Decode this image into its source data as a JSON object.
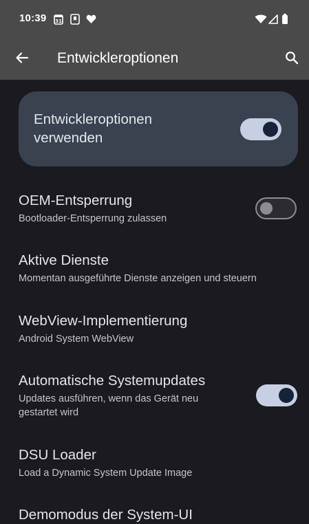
{
  "status_bar": {
    "time": "10:39",
    "left_icons": [
      "calendar-icon",
      "bookmark-icon",
      "heart-icon"
    ],
    "right_icons": [
      "wifi-icon",
      "signal-icon",
      "battery-icon"
    ],
    "calendar_day": "31"
  },
  "app_bar": {
    "title": "Entwickleroptionen",
    "back_icon": "arrow-back-icon",
    "search_icon": "search-icon"
  },
  "master_toggle": {
    "label": "Entwickleroptionen verwenden",
    "checked": true
  },
  "settings": [
    {
      "title": "OEM-Entsperrung",
      "subtitle": "Bootloader-Entsperrung zulassen",
      "toggle": false
    },
    {
      "title": "Aktive Dienste",
      "subtitle": "Momentan ausgeführte Dienste anzeigen und steuern"
    },
    {
      "title": "WebView-Implementierung",
      "subtitle": "Android System WebView"
    },
    {
      "title": "Automatische Systemupdates",
      "subtitle": "Updates ausführen, wenn das Gerät neu gestartet wird",
      "toggle": true
    },
    {
      "title": "DSU Loader",
      "subtitle": "Load a Dynamic System Update Image"
    },
    {
      "title": "Demomodus der System-UI"
    }
  ],
  "colors": {
    "background": "#1b1a1f",
    "appbar": "#4a4a4a",
    "card": "#3a4250",
    "switch_on_track": "#c6d0e2",
    "switch_on_knob": "#15243a",
    "switch_off_outline": "#8e8c92"
  }
}
